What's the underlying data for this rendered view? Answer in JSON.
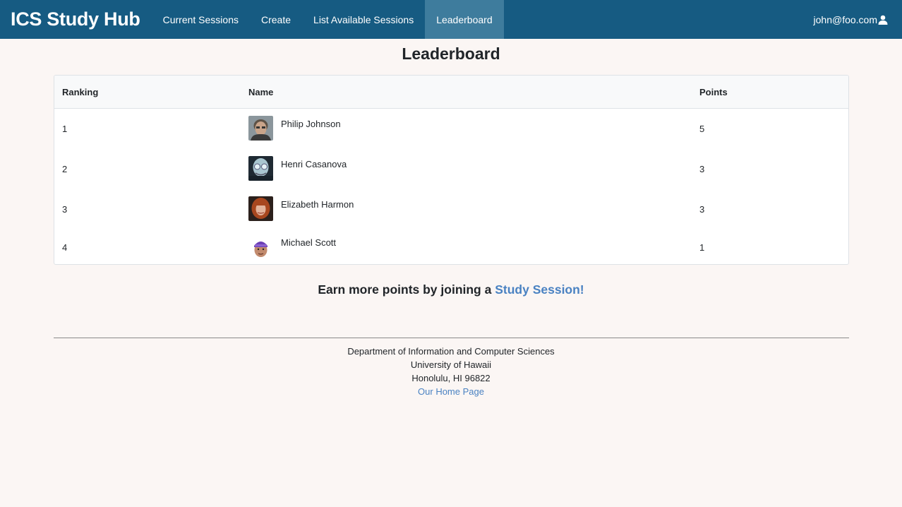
{
  "nav": {
    "brand": "ICS Study Hub",
    "items": [
      {
        "label": "Current Sessions"
      },
      {
        "label": "Create"
      },
      {
        "label": "List Available Sessions"
      },
      {
        "label": "Leaderboard"
      }
    ],
    "user": "john@foo.com",
    "user_icon": "user-icon"
  },
  "page": {
    "title": "Leaderboard"
  },
  "table": {
    "headers": [
      "Ranking",
      "Name",
      "Points"
    ],
    "rows": [
      {
        "rank": "1",
        "name": "Philip Johnson",
        "points": "5",
        "avatar": "avatar-philip-johnson"
      },
      {
        "rank": "2",
        "name": "Henri Casanova",
        "points": "3",
        "avatar": "avatar-henri-casanova"
      },
      {
        "rank": "3",
        "name": "Elizabeth Harmon",
        "points": "3",
        "avatar": "avatar-elizabeth-harmon"
      },
      {
        "rank": "4",
        "name": "Michael Scott",
        "points": "1",
        "avatar": "avatar-michael-scott"
      }
    ]
  },
  "cta": {
    "text": "Earn more points by joining a ",
    "link": "Study Session!"
  },
  "footer": {
    "line1": "Department of Information and Computer Sciences",
    "line2": "University of Hawaii",
    "line3": "Honolulu, HI 96822",
    "link": "Our Home Page"
  },
  "colors": {
    "navbar": "#165b82",
    "nav_active": "#3e7c9d",
    "background": "#fbf6f4",
    "link": "#4a82c2"
  }
}
